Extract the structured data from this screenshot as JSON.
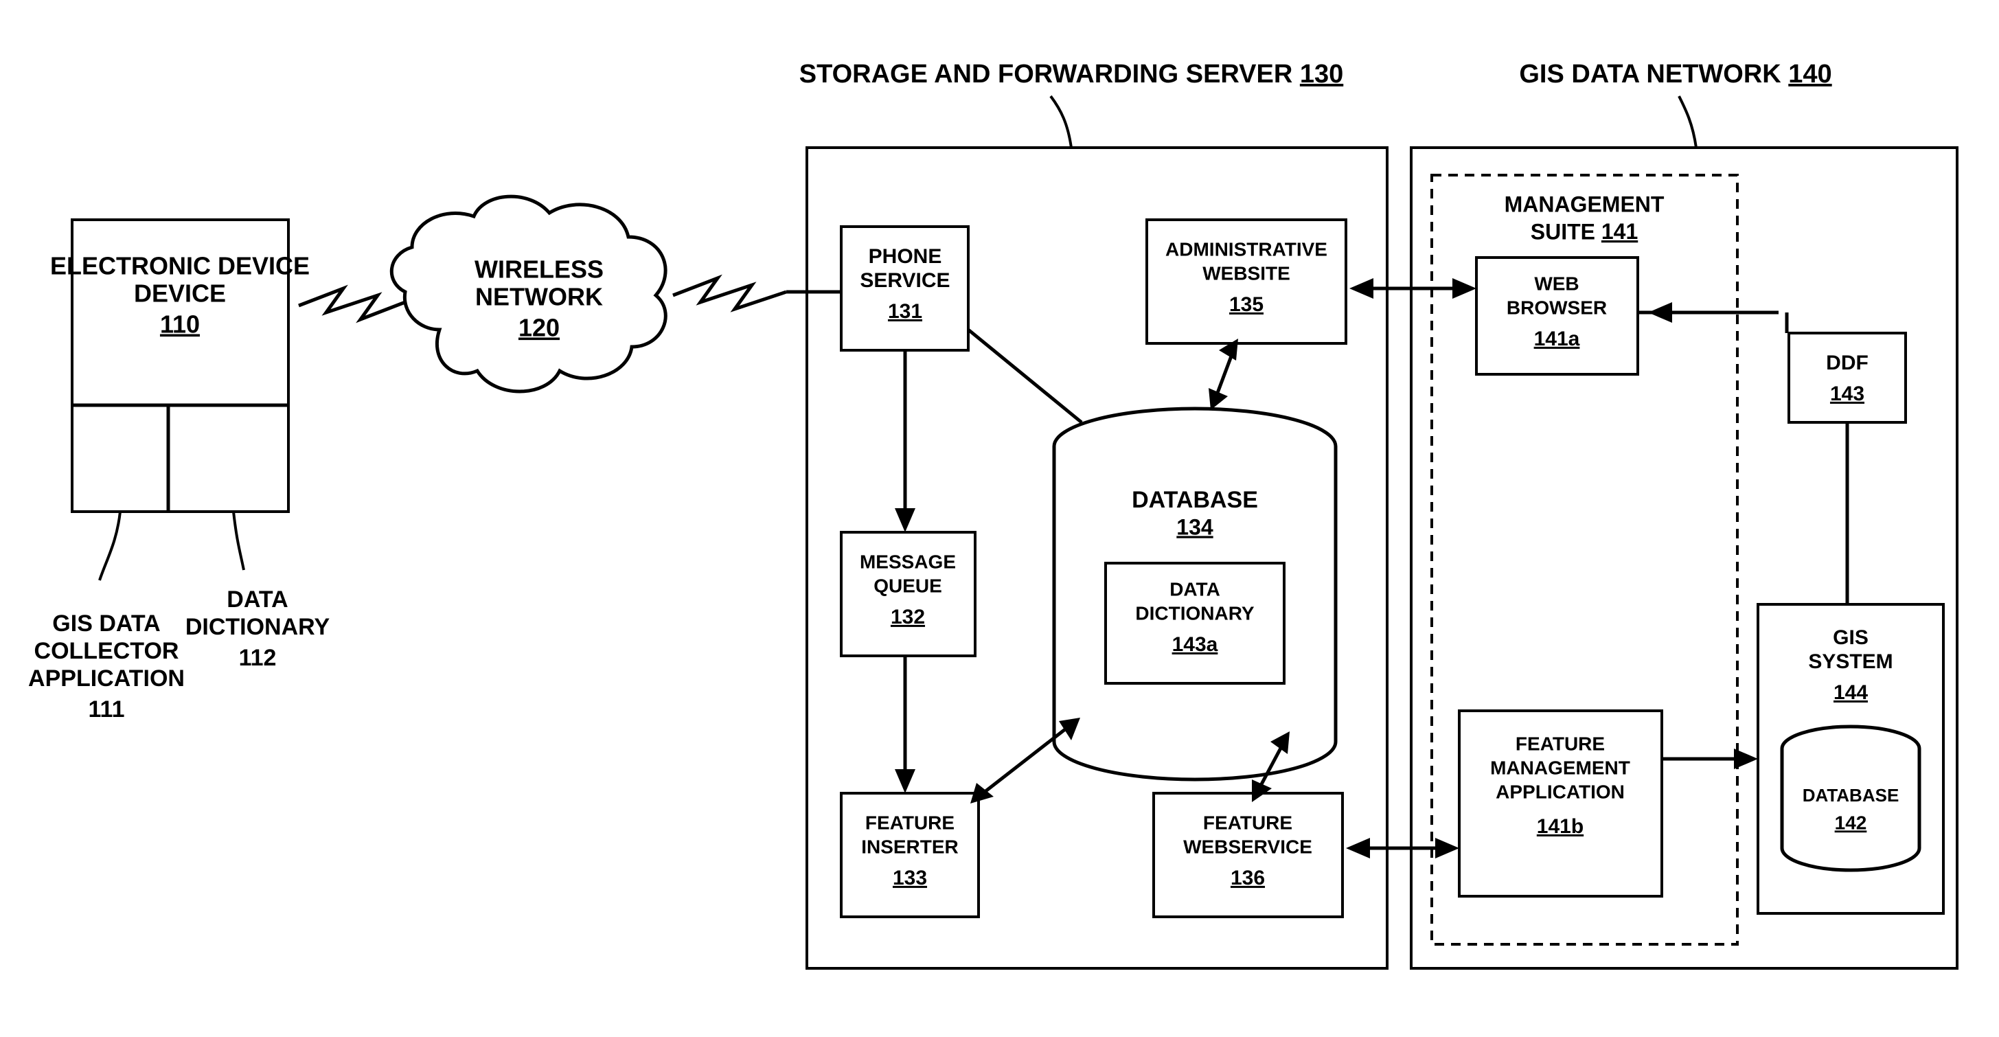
{
  "device": {
    "title": "ELECTRONIC DEVICE",
    "ref": "110"
  },
  "app": {
    "title": "GIS DATA COLLECTOR APPLICATION",
    "ref": "111"
  },
  "dict": {
    "title": "DATA DICTIONARY",
    "ref": "112"
  },
  "wireless": {
    "title": "WIRELESS NETWORK",
    "ref": "120"
  },
  "server": {
    "title": "STORAGE AND FORWARDING SERVER",
    "ref": "130"
  },
  "phone": {
    "title": "PHONE SERVICE",
    "ref": "131"
  },
  "mqueue": {
    "title": "MESSAGE QUEUE",
    "ref": "132"
  },
  "finserter": {
    "title": "FEATURE INSERTER",
    "ref": "133"
  },
  "database": {
    "title": "DATABASE",
    "ref": "134"
  },
  "ddict": {
    "title": "DATA DICTIONARY",
    "ref": "143a"
  },
  "admin": {
    "title": "ADMINISTRATIVE WEBSITE",
    "ref": "135"
  },
  "fws": {
    "title": "FEATURE WEBSERVICE",
    "ref": "136"
  },
  "gisnet": {
    "title": "GIS DATA NETWORK",
    "ref": "140"
  },
  "suite": {
    "title": "MANAGEMENT SUITE",
    "ref": "141"
  },
  "browser": {
    "title": "WEB BROWSER",
    "ref": "141a"
  },
  "fma": {
    "title": "FEATURE MANAGEMENT APPLICATION",
    "ref": "141b"
  },
  "ddf": {
    "title": "DDF",
    "ref": "143"
  },
  "gissys": {
    "title": "GIS SYSTEM",
    "ref": "144"
  },
  "gdb": {
    "title": "DATABASE",
    "ref": "142"
  }
}
